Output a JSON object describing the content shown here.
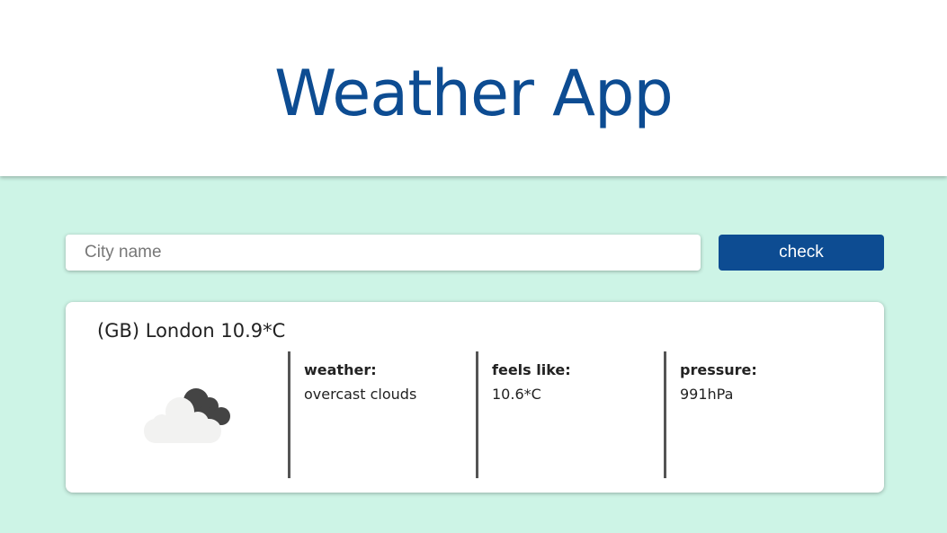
{
  "header": {
    "title": "Weather App"
  },
  "search": {
    "placeholder": "City name",
    "value": "",
    "button_label": "check"
  },
  "result": {
    "title": "(GB) London 10.9*C",
    "icon": "overcast-clouds-icon",
    "details": [
      {
        "label": "weather:",
        "value": "overcast clouds"
      },
      {
        "label": "feels like:",
        "value": "10.6*C"
      },
      {
        "label": "pressure:",
        "value": "991hPa"
      }
    ]
  },
  "colors": {
    "brand": "#0d4c92",
    "background": "#cdf4e6"
  }
}
